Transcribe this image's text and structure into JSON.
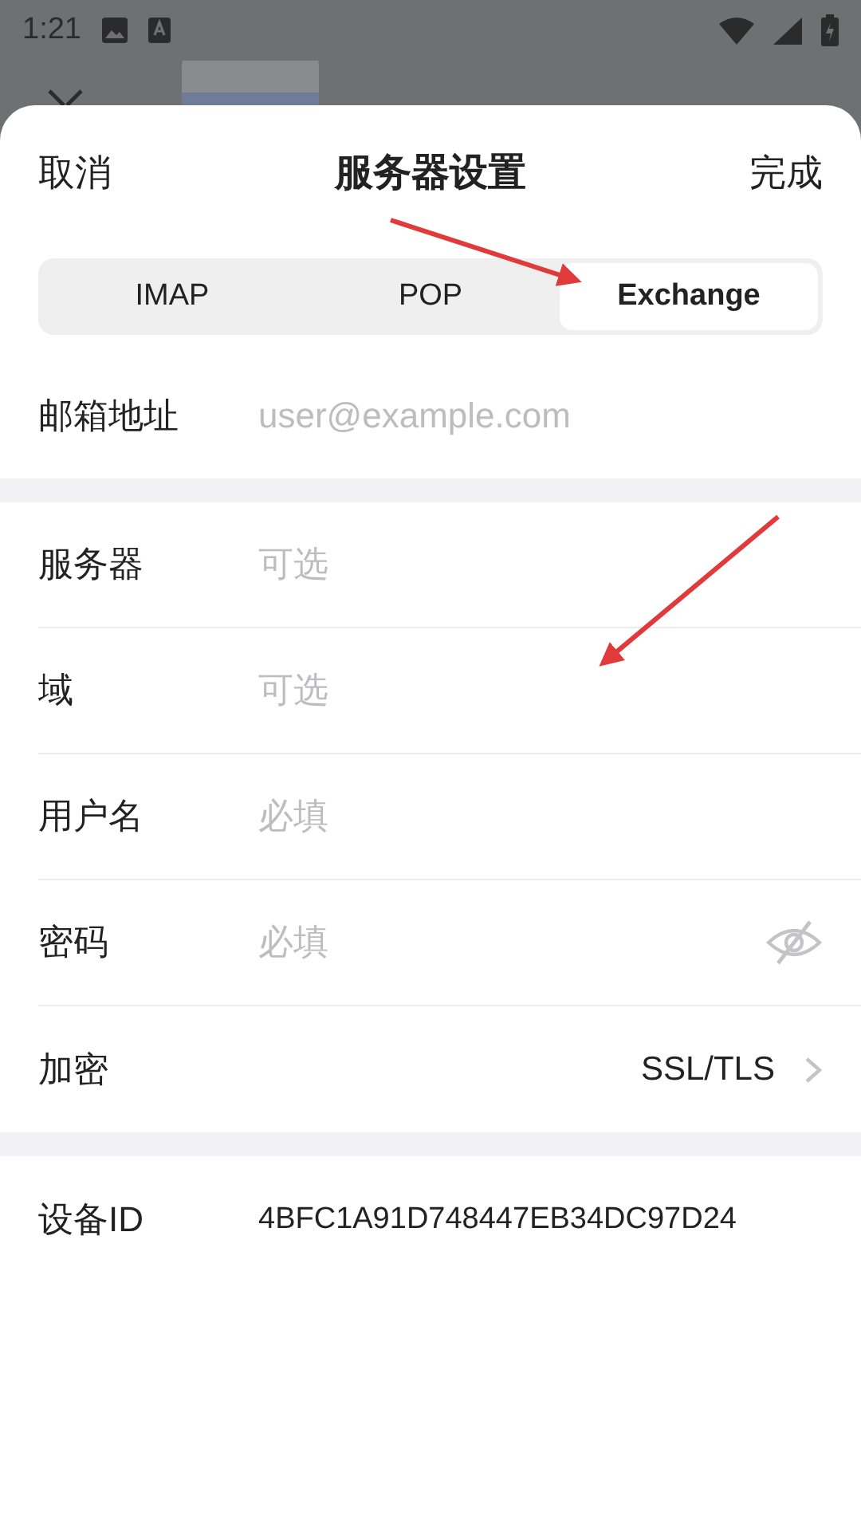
{
  "status_bar": {
    "time": "1:21"
  },
  "header": {
    "cancel": "取消",
    "title": "服务器设置",
    "done": "完成"
  },
  "tabs": [
    {
      "label": "IMAP",
      "selected": false
    },
    {
      "label": "POP",
      "selected": false
    },
    {
      "label": "Exchange",
      "selected": true
    }
  ],
  "email_field": {
    "label": "邮箱地址",
    "placeholder": "user@example.com"
  },
  "fields": [
    {
      "kind": "input",
      "label": "服务器",
      "placeholder": "可选"
    },
    {
      "kind": "input",
      "label": "域",
      "placeholder": "可选"
    },
    {
      "kind": "input",
      "label": "用户名",
      "placeholder": "必填"
    },
    {
      "kind": "password",
      "label": "密码",
      "placeholder": "必填"
    },
    {
      "kind": "select",
      "label": "加密",
      "value": "SSL/TLS"
    }
  ],
  "device": {
    "label": "设备ID",
    "value": "4BFC1A91D748447EB34DC97D24"
  }
}
